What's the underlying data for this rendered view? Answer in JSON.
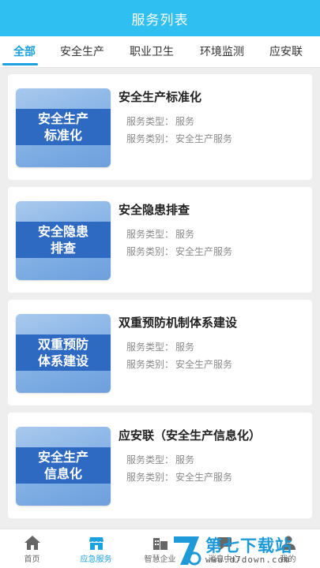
{
  "header": {
    "title": "服务列表"
  },
  "tabs": [
    {
      "label": "全部",
      "active": true
    },
    {
      "label": "安全生产"
    },
    {
      "label": "职业卫生"
    },
    {
      "label": "环境监测"
    },
    {
      "label": "应安联"
    }
  ],
  "meta_labels": {
    "type": "服务类型：",
    "category": "服务类别："
  },
  "services": [
    {
      "title": "安全生产标准化",
      "thumb_line1": "安全生产",
      "thumb_line2": "标准化",
      "type": "服务",
      "category": "安全生产服务"
    },
    {
      "title": "安全隐患排查",
      "thumb_line1": "安全隐患",
      "thumb_line2": "排查",
      "type": "服务",
      "category": "安全生产服务"
    },
    {
      "title": "双重预防机制体系建设",
      "thumb_line1": "双重预防",
      "thumb_line2": "体系建设",
      "type": "服务",
      "category": "安全生产服务"
    },
    {
      "title": "应安联（安全生产信息化）",
      "thumb_line1": "安全生产",
      "thumb_line2": "信息化",
      "type": "服务",
      "category": "安全生产服务"
    }
  ],
  "bottom_nav": [
    {
      "label": "首页",
      "icon": "home-icon"
    },
    {
      "label": "应急服务",
      "icon": "service-icon",
      "active": true
    },
    {
      "label": "智慧企业",
      "icon": "enterprise-icon"
    },
    {
      "label": "消息中心",
      "icon": "message-icon"
    },
    {
      "label": "我的",
      "icon": "user-icon"
    }
  ],
  "watermark": {
    "text": "第七下载站",
    "url": "www.d7down.com"
  },
  "colors": {
    "header": "#2fbff0",
    "accent": "#1aa1de",
    "thumb_band": "#2f6ac2"
  }
}
